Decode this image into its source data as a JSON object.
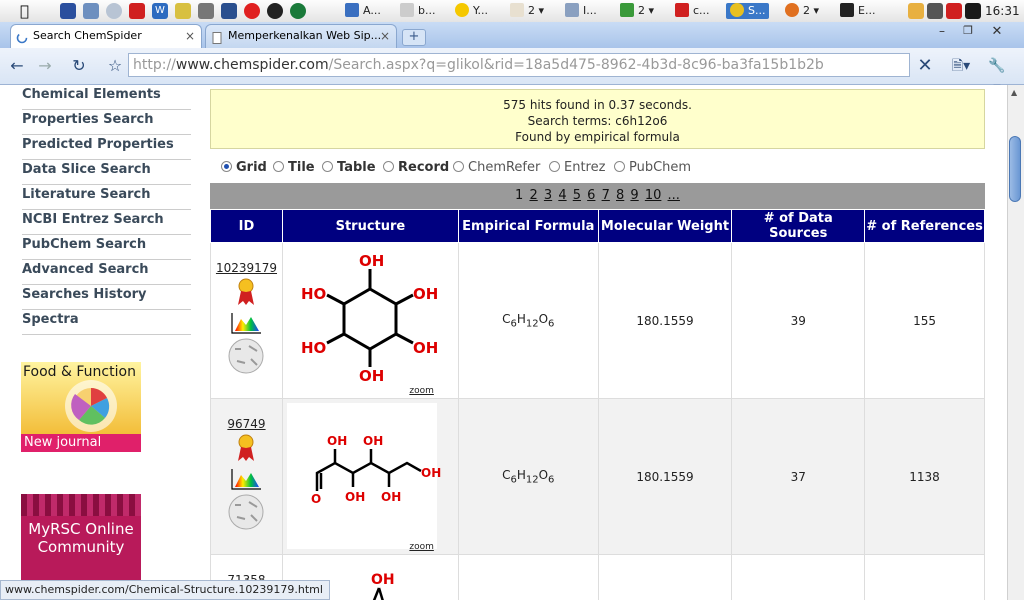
{
  "taskbar": {
    "items": [
      {
        "label": "A...",
        "icon": "doc-icon"
      },
      {
        "label": "b...",
        "icon": "doc-icon"
      },
      {
        "label": "Y...",
        "icon": "messenger-icon"
      },
      {
        "label": "2",
        "icon": "java-icon"
      },
      {
        "label": "I...",
        "icon": "picture-icon"
      },
      {
        "label": "2",
        "icon": "network-icon"
      },
      {
        "label": "c...",
        "icon": "gear-icon"
      },
      {
        "label": "S...",
        "icon": "chrome-icon"
      },
      {
        "label": "2",
        "icon": "firefox-icon"
      },
      {
        "label": "E...",
        "icon": "terminal-icon"
      }
    ],
    "clock": "16:31"
  },
  "tabs": [
    {
      "label": "Search ChemSpider",
      "active": true
    },
    {
      "label": "Memperkenalkan Web Sip...",
      "active": false
    }
  ],
  "url": {
    "host": "http://www.chemspider.com",
    "path": "/Search.aspx?q=glikol&rid=18a5d475-8962-4b3d-8c96-ba3fa15b1b2b",
    "scheme": "http://",
    "domain": "www.chemspider.com"
  },
  "sidebar": {
    "links": [
      "Chemical Elements",
      "Properties Search",
      "Predicted Properties",
      "Data Slice Search",
      "Literature Search",
      "NCBI Entrez Search",
      "PubChem Search",
      "Advanced Search",
      "Searches History",
      "Spectra"
    ],
    "ad1": {
      "title": "Food & Function",
      "subtitle": "New journal"
    },
    "ad2": {
      "title": "MyRSC Online Community"
    }
  },
  "results": {
    "hits": "575 hits found in 0.37 seconds.",
    "terms": "Search terms: c6h12o6",
    "found_by": "Found by empirical formula",
    "views": [
      "Grid",
      "Tile",
      "Table",
      "Record",
      "ChemRefer",
      "Entrez",
      "PubChem"
    ],
    "pages": [
      "1",
      "2",
      "3",
      "4",
      "5",
      "6",
      "7",
      "8",
      "9",
      "10",
      "..."
    ],
    "columns": [
      "ID",
      "Structure",
      "Empirical Formula",
      "Molecular Weight",
      "# of Data Sources",
      "# of References"
    ],
    "rows": [
      {
        "id": "10239179",
        "weight": "180.1559",
        "sources": "39",
        "refs": "155"
      },
      {
        "id": "96749",
        "weight": "180.1559",
        "sources": "37",
        "refs": "1138"
      },
      {
        "id": "71358",
        "weight": "",
        "sources": "",
        "refs": ""
      }
    ],
    "zoom_label": "zoom"
  },
  "status": "www.chemspider.com/Chemical-Structure.10239179.html",
  "colors": {
    "header": "#000080",
    "hitbox": "#ffffcc",
    "pager": "#9a9a9a",
    "molecule_red": "#dd0000"
  }
}
